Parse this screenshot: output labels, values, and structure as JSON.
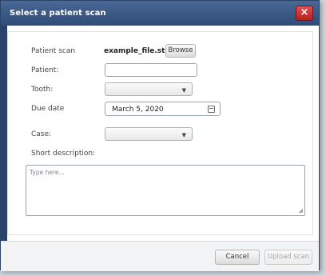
{
  "dialog": {
    "title": "Select a patient scan",
    "close_symbol": "×"
  },
  "form": {
    "patient_scan_label": "Patient scan",
    "patient_scan_file": "example_file.stl",
    "browse_label": "Browse",
    "patient_label": "Patient:",
    "patient_value": "",
    "tooth_label": "Tooth:",
    "tooth_value": "",
    "due_date_label": "Due date",
    "due_date_value": "March 5, 2020",
    "case_label": "Case:",
    "case_value": "",
    "description_label": "Short description:",
    "description_placeholder": "Type here..."
  },
  "footer": {
    "cancel_label": "Cancel",
    "upload_label": "Upload scan"
  },
  "icons": {
    "dropdown": "▼",
    "resize": "◢"
  },
  "colors": {
    "titlebar": "#3b5784",
    "close": "#c72b2b"
  }
}
